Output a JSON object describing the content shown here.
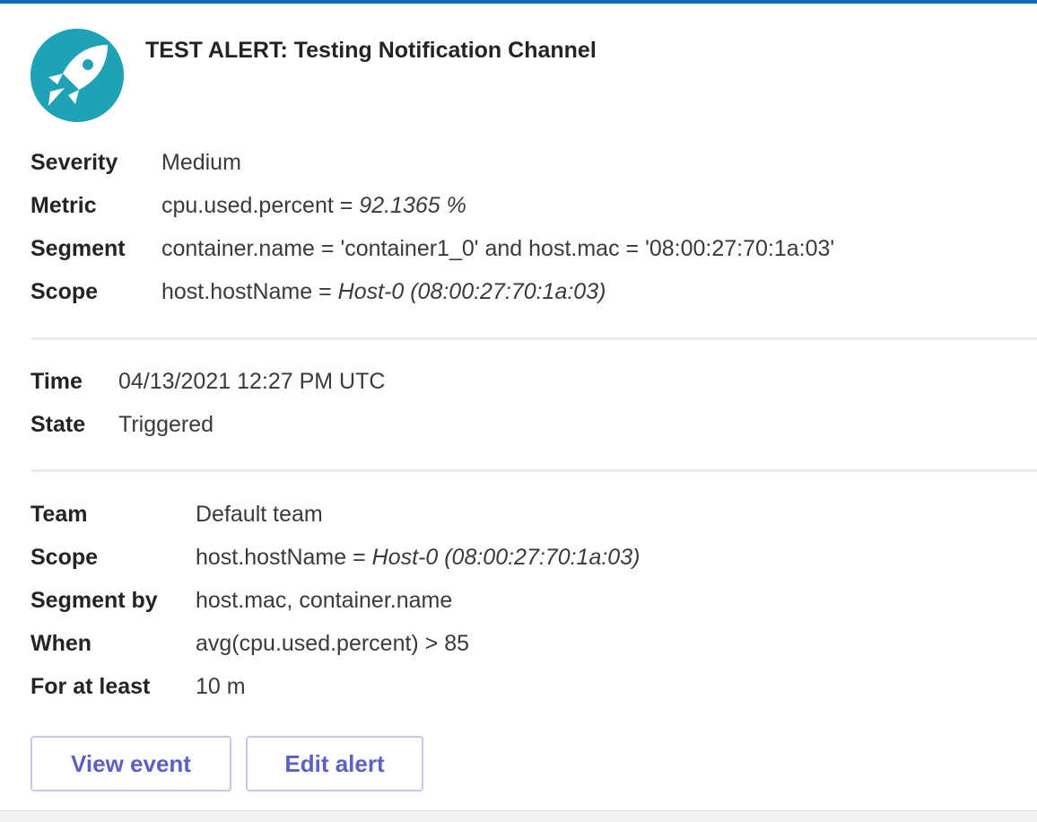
{
  "card": {
    "accent_color": "#0f6cbd",
    "logo_icon": "rocket-logo-icon",
    "logo_color": "#1fa2b5",
    "title": "TEST ALERT: Testing Notification Channel"
  },
  "alert_details": [
    {
      "label": "Severity",
      "value": "Medium",
      "value_em": ""
    },
    {
      "label": "Metric",
      "value": "cpu.used.percent = ",
      "value_em": "92.1365 %"
    },
    {
      "label": "Segment",
      "value": "container.name = 'container1_0' and host.mac = '08:00:27:70:1a:03'",
      "value_em": ""
    },
    {
      "label": "Scope",
      "value": "host.hostName = ",
      "value_em": "Host-0 (08:00:27:70:1a:03)"
    }
  ],
  "event_info": [
    {
      "label": "Time",
      "value": "04/13/2021 12:27 PM UTC"
    },
    {
      "label": "State",
      "value": "Triggered"
    }
  ],
  "alert_config": [
    {
      "label": "Team",
      "value": "Default team",
      "value_em": ""
    },
    {
      "label": "Scope",
      "value": "host.hostName = ",
      "value_em": "Host-0 (08:00:27:70:1a:03)"
    },
    {
      "label": "Segment by",
      "value": "host.mac, container.name",
      "value_em": ""
    },
    {
      "label": "When",
      "value": "avg(cpu.used.percent) > 85",
      "value_em": ""
    },
    {
      "label": "For at least",
      "value": "10 m",
      "value_em": ""
    }
  ],
  "actions": {
    "view_event_label": "View event",
    "edit_alert_label": "Edit alert"
  },
  "colors": {
    "button_text": "#5b5fc7",
    "button_border": "#c8c6e6"
  }
}
